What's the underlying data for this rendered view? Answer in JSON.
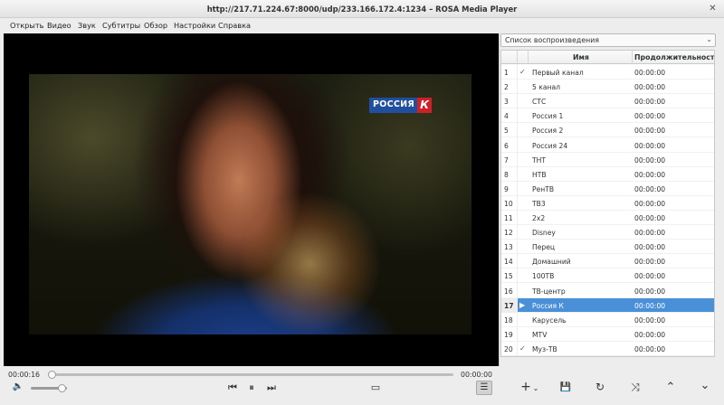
{
  "window": {
    "title": "http://217.71.224.67:8000/udp/233.166.172.4:1234 – ROSA Media Player",
    "close_glyph": "✕"
  },
  "menu": [
    "Открыть",
    "Видео",
    "Звук",
    "Субтитры",
    "Обзор",
    "Настройки",
    "Справка"
  ],
  "video": {
    "channel_logo": "РОССИЯ",
    "channel_logo_letter": "К"
  },
  "playlist": {
    "header_label": "Список воспроизведения",
    "dropdown_glyph": "⌄",
    "col_name": "Имя",
    "col_duration": "Продолжительность",
    "rows": [
      {
        "num": "1",
        "check": "✓",
        "name": "Первый канал",
        "dur": "00:00:00"
      },
      {
        "num": "2",
        "check": "",
        "name": "5 канал",
        "dur": "00:00:00"
      },
      {
        "num": "3",
        "check": "",
        "name": "СТС",
        "dur": "00:00:00"
      },
      {
        "num": "4",
        "check": "",
        "name": "Россия 1",
        "dur": "00:00:00"
      },
      {
        "num": "5",
        "check": "",
        "name": "Россия 2",
        "dur": "00:00:00"
      },
      {
        "num": "6",
        "check": "",
        "name": "Россия 24",
        "dur": "00:00:00"
      },
      {
        "num": "7",
        "check": "",
        "name": "ТНТ",
        "dur": "00:00:00"
      },
      {
        "num": "8",
        "check": "",
        "name": "НТВ",
        "dur": "00:00:00"
      },
      {
        "num": "9",
        "check": "",
        "name": "РенТВ",
        "dur": "00:00:00"
      },
      {
        "num": "10",
        "check": "",
        "name": "ТВ3",
        "dur": "00:00:00"
      },
      {
        "num": "11",
        "check": "",
        "name": "2x2",
        "dur": "00:00:00"
      },
      {
        "num": "12",
        "check": "",
        "name": "Disney",
        "dur": "00:00:00"
      },
      {
        "num": "13",
        "check": "",
        "name": "Перец",
        "dur": "00:00:00"
      },
      {
        "num": "14",
        "check": "",
        "name": "Домашний",
        "dur": "00:00:00"
      },
      {
        "num": "15",
        "check": "",
        "name": "100ТВ",
        "dur": "00:00:00"
      },
      {
        "num": "16",
        "check": "",
        "name": "ТВ-центр",
        "dur": "00:00:00"
      },
      {
        "num": "17",
        "check": "▶",
        "name": "Россия К",
        "dur": "00:00:00",
        "selected": true
      },
      {
        "num": "18",
        "check": "",
        "name": "Карусель",
        "dur": "00:00:00"
      },
      {
        "num": "19",
        "check": "",
        "name": "MTV",
        "dur": "00:00:00"
      },
      {
        "num": "20",
        "check": "✓",
        "name": "Муз-ТВ",
        "dur": "00:00:00"
      }
    ]
  },
  "controls": {
    "time_elapsed": "00:00:16",
    "time_total": "00:00:00",
    "seek_progress": 0,
    "volume_level": 0.85,
    "glyphs": {
      "volume": "🔈",
      "prev": "⏮",
      "pause": "⏸",
      "next": "⏭",
      "fullscreen": "▭",
      "playlist": "☰",
      "add": "+",
      "add_menu": "⌄",
      "save": "💾",
      "repeat": "↻",
      "shuffle": "⤨",
      "move_up": "⌃",
      "move_down": "⌄"
    }
  },
  "colors": {
    "selection": "#4a90d9",
    "channel_blue": "#1f4f9e",
    "channel_red": "#d11f27"
  }
}
